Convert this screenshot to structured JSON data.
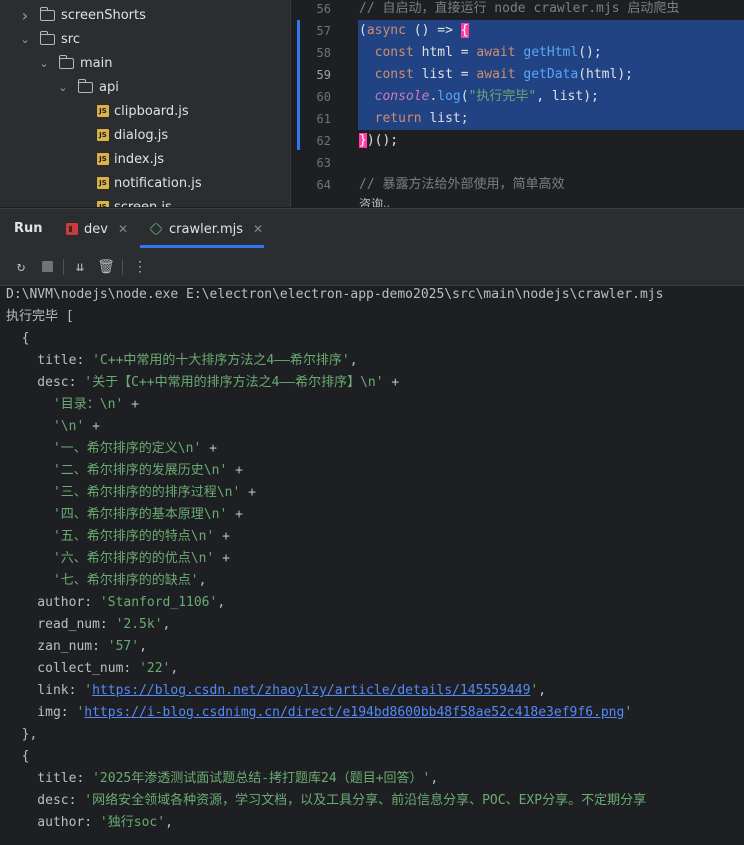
{
  "tree": [
    {
      "name": "screenShorts",
      "type": "folder",
      "expanded": false,
      "depth": 2
    },
    {
      "name": "src",
      "type": "folder",
      "expanded": true,
      "depth": 2
    },
    {
      "name": "main",
      "type": "folder",
      "expanded": true,
      "depth": 3
    },
    {
      "name": "api",
      "type": "folder",
      "expanded": true,
      "depth": 4
    },
    {
      "name": "clipboard.js",
      "type": "js",
      "depth": 5
    },
    {
      "name": "dialog.js",
      "type": "js",
      "depth": 5
    },
    {
      "name": "index.js",
      "type": "js",
      "depth": 5
    },
    {
      "name": "notification.js",
      "type": "js",
      "depth": 5
    },
    {
      "name": "screen.js",
      "type": "js",
      "depth": 5
    }
  ],
  "editor": {
    "line_numbers": [
      "56",
      "57",
      "58",
      "59",
      "60",
      "61",
      "62",
      "63",
      "64"
    ],
    "comment1": "// 自启动，直接运行 node crawler.mjs 启动爬虫",
    "comment2": "// 暴露方法给外部使用，简单高效",
    "partial": "咨询"
  },
  "run": {
    "label": "Run",
    "tabs": [
      {
        "label": "dev"
      },
      {
        "label": "crawler.mjs",
        "active": true
      }
    ]
  },
  "console": {
    "command": "D:\\NVM\\nodejs\\node.exe E:\\electron\\electron-app-demo2025\\src\\main\\nodejs\\crawler.mjs",
    "done": "执行完毕 [",
    "item1": {
      "title": "'C++中常用的十大排序方法之4——希尔排序'",
      "desc": [
        "'关于【C++中常用的排序方法之4——希尔排序】\\n'",
        "'目录：\\n'",
        "'\\n'",
        "'一、希尔排序的定义\\n'",
        "'二、希尔排序的发展历史\\n'",
        "'三、希尔排序的的排序过程\\n'",
        "'四、希尔排序的基本原理\\n'",
        "'五、希尔排序的的特点\\n'",
        "'六、希尔排序的的优点\\n'",
        "'七、希尔排序的的缺点'"
      ],
      "author": "'Stanford_1106'",
      "read_num": "'2.5k'",
      "zan_num": "'57'",
      "collect_num": "'22'",
      "link": "https://blog.csdn.net/zhaoylzy/article/details/145559449",
      "img": "https://i-blog.csdnimg.cn/direct/e194bd8600bb48f58ae52c418e3ef9f6.png"
    },
    "item2": {
      "title": "'2025年渗透测试面试题总结-拷打题库24（题目+回答）'",
      "desc": "'网络安全领域各种资源，学习文档，以及工具分享、前沿信息分享、POC、EXP分享。不定期分享",
      "author": "'独行soc'"
    }
  },
  "colors": {
    "accent": "#3574f0",
    "string": "#6aab73",
    "link": "#548af7"
  }
}
